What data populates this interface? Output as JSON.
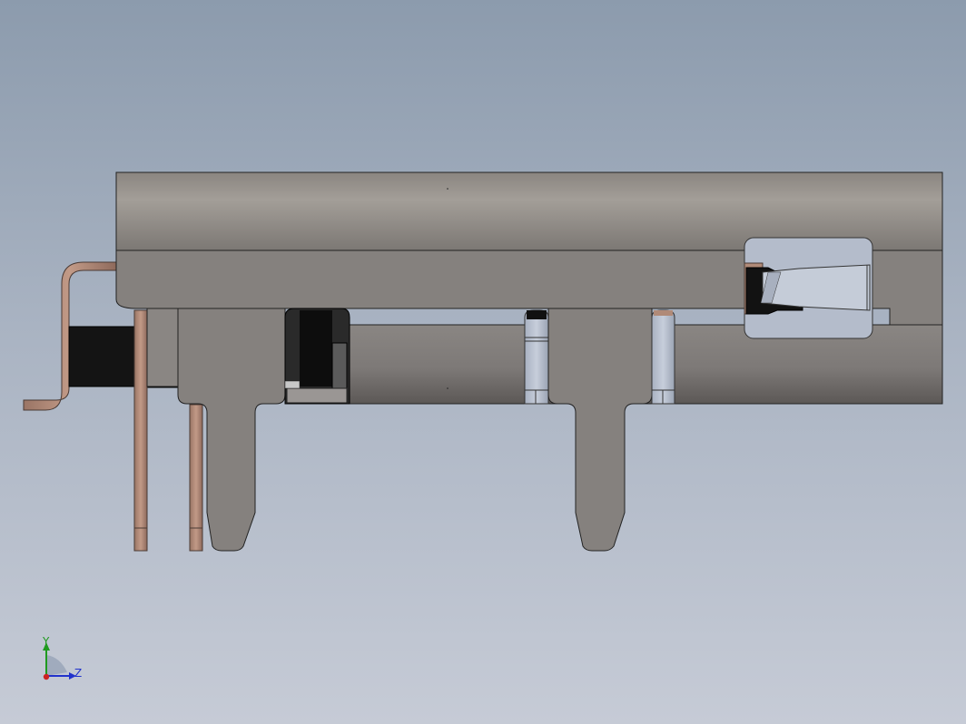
{
  "viewport": {
    "background_top": "#8c9bad",
    "background_bottom": "#c6cbd6"
  },
  "model": {
    "body_color": "#86827f",
    "body_highlight": "#a29d98",
    "insulator_color": "#111111",
    "contact_color": "#b08a78",
    "glass_color": "#b4bccb"
  },
  "triad": {
    "y_label": "Y",
    "z_label": "Z",
    "y_color": "#1f9a1f",
    "z_color": "#2233cc",
    "origin_color": "#cc2222"
  }
}
